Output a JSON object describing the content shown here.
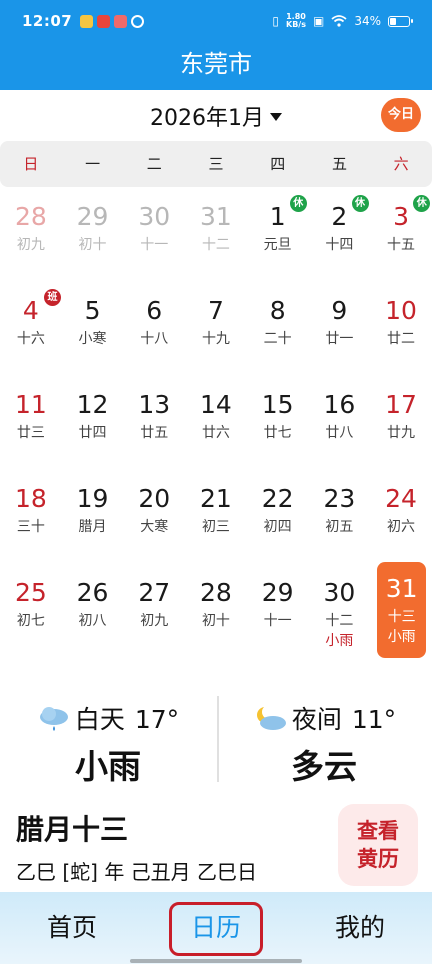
{
  "status_bar": {
    "time": "12:07",
    "net_speed_value": "1.80",
    "net_speed_unit": "KB/s",
    "battery": "34%",
    "battery_level": 0.34
  },
  "header": {
    "title": "东莞市"
  },
  "calendar": {
    "month_label": "2026年1月",
    "today_button": "今日",
    "weekdays": [
      "日",
      "一",
      "二",
      "三",
      "四",
      "五",
      "六"
    ],
    "badges": {
      "rest": "休",
      "work": "班"
    },
    "days": [
      {
        "day": "28",
        "lunar": "初九",
        "other_month": true
      },
      {
        "day": "29",
        "lunar": "初十",
        "other_month": true
      },
      {
        "day": "30",
        "lunar": "十一",
        "other_month": true
      },
      {
        "day": "31",
        "lunar": "十二",
        "other_month": true
      },
      {
        "day": "1",
        "lunar": "元旦",
        "badge": "rest"
      },
      {
        "day": "2",
        "lunar": "十四",
        "badge": "rest"
      },
      {
        "day": "3",
        "lunar": "十五",
        "badge": "rest"
      },
      {
        "day": "4",
        "lunar": "十六",
        "badge": "work"
      },
      {
        "day": "5",
        "lunar": "小寒"
      },
      {
        "day": "6",
        "lunar": "十八"
      },
      {
        "day": "7",
        "lunar": "十九"
      },
      {
        "day": "8",
        "lunar": "二十"
      },
      {
        "day": "9",
        "lunar": "廿一"
      },
      {
        "day": "10",
        "lunar": "廿二"
      },
      {
        "day": "11",
        "lunar": "廿三"
      },
      {
        "day": "12",
        "lunar": "廿四"
      },
      {
        "day": "13",
        "lunar": "廿五"
      },
      {
        "day": "14",
        "lunar": "廿六"
      },
      {
        "day": "15",
        "lunar": "廿七"
      },
      {
        "day": "16",
        "lunar": "廿八"
      },
      {
        "day": "17",
        "lunar": "廿九"
      },
      {
        "day": "18",
        "lunar": "三十"
      },
      {
        "day": "19",
        "lunar": "腊月"
      },
      {
        "day": "20",
        "lunar": "大寒"
      },
      {
        "day": "21",
        "lunar": "初三"
      },
      {
        "day": "22",
        "lunar": "初四"
      },
      {
        "day": "23",
        "lunar": "初五"
      },
      {
        "day": "24",
        "lunar": "初六"
      },
      {
        "day": "25",
        "lunar": "初七"
      },
      {
        "day": "26",
        "lunar": "初八"
      },
      {
        "day": "27",
        "lunar": "初九"
      },
      {
        "day": "28",
        "lunar": "初十"
      },
      {
        "day": "29",
        "lunar": "十一"
      },
      {
        "day": "30",
        "lunar": "十二",
        "extra": "小雨"
      },
      {
        "day": "31",
        "lunar": "十三",
        "extra": "小雨",
        "selected": true
      }
    ]
  },
  "weather": {
    "day": {
      "label": "白天",
      "temp": "17°",
      "condition": "小雨",
      "icon": "rain-cloud-icon"
    },
    "night": {
      "label": "夜间",
      "temp": "11°",
      "condition": "多云",
      "icon": "moon-cloud-icon"
    }
  },
  "lunar_info": {
    "date": "腊月十三",
    "ganzhi": "乙巳 [蛇] 年 己丑月 乙巳日"
  },
  "huangli_button": {
    "line1": "查看",
    "line2": "黄历"
  },
  "tabs": [
    {
      "label": "首页"
    },
    {
      "label": "日历",
      "active": true
    },
    {
      "label": "我的"
    }
  ],
  "colors": {
    "accent_blue": "#1a95e8",
    "accent_orange": "#f26c2f",
    "holiday_red": "#c5232b",
    "rest_green": "#1fa34a"
  }
}
